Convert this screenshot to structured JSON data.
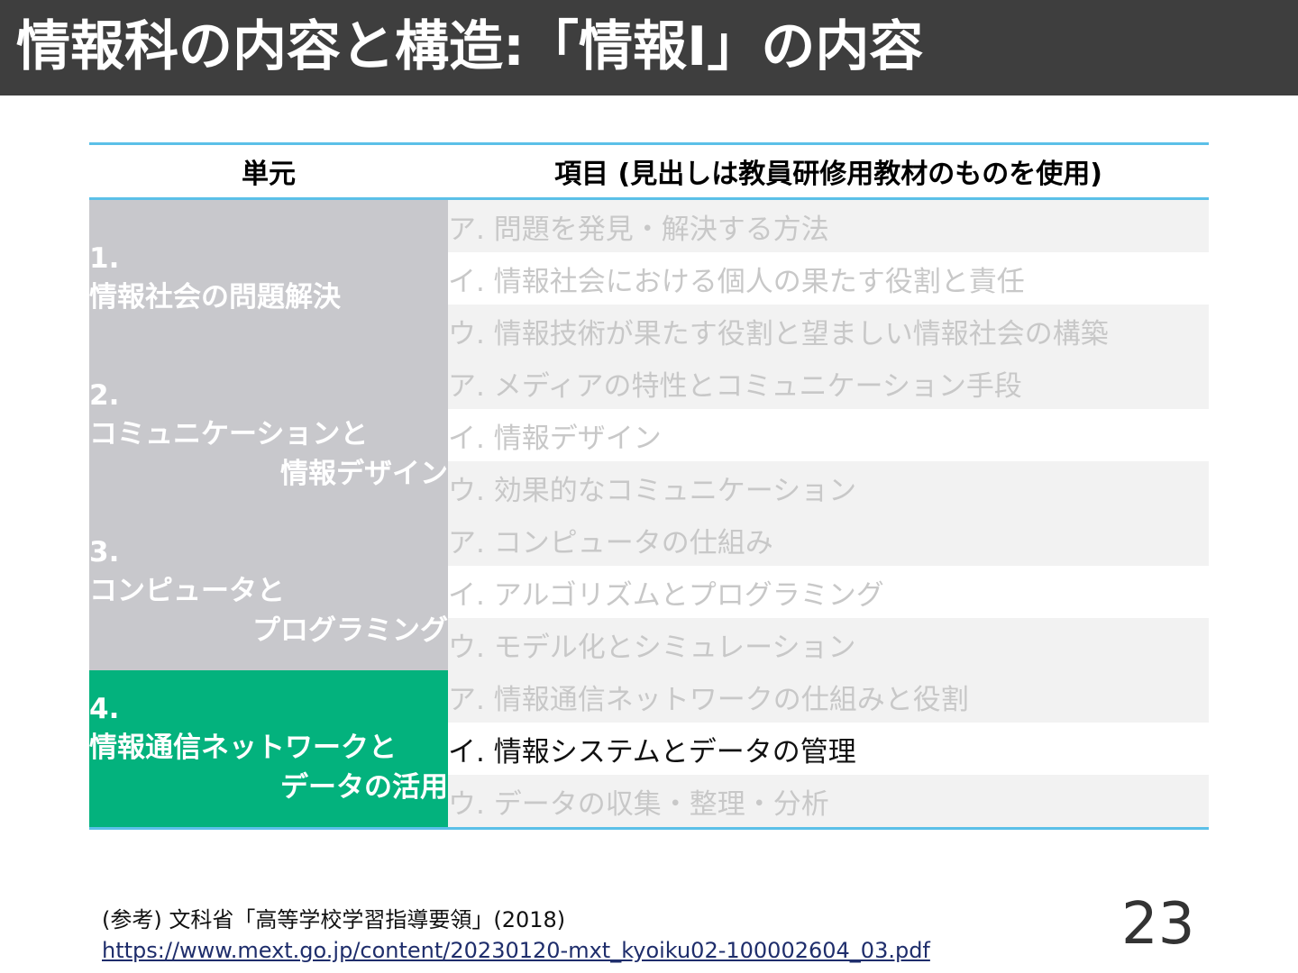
{
  "title": "情報科の内容と構造:「情報I」の内容",
  "table": {
    "headers": [
      "単元",
      "項目 (見出しは教員研修用教材のものを使用)"
    ],
    "units": [
      {
        "number": "1.",
        "line1": "情報社会の問題解決",
        "line2": "",
        "color": "#c8c8cc"
      },
      {
        "number": "2.",
        "line1": "コミュニケーションと",
        "line2": "情報デザイン",
        "color": "#c8c8cc"
      },
      {
        "number": "3.",
        "line1": "コンピュータと",
        "line2": "プログラミング",
        "color": "#c8c8cc"
      },
      {
        "number": "4.",
        "line1": "情報通信ネットワークと",
        "line2": "データの活用",
        "color": "#03b27d"
      }
    ],
    "items": [
      "ア. 問題を発見・解決する方法",
      "イ. 情報社会における個人の果たす役割と責任",
      "ウ. 情報技術が果たす役割と望ましい情報社会の構築",
      "ア. メディアの特性とコミュニケーション手段",
      "イ. 情報デザイン",
      "ウ. 効果的なコミュニケーション",
      "ア. コンピュータの仕組み",
      "イ. アルゴリズムとプログラミング",
      "ウ. モデル化とシミュレーション",
      "ア. 情報通信ネットワークの仕組みと役割",
      "イ. 情報システムとデータの管理",
      "ウ. データの収集・整理・分析"
    ],
    "highlighted_item_color": "#111111",
    "dimmed_item_color": "#c8c8c8"
  },
  "reference": {
    "text": "(参考) 文科省「高等学校学習指導要領」(2018)",
    "url": "https://www.mext.go.jp/content/20230120-mxt_kyoiku02-100002604_03.pdf"
  },
  "page_number": "23"
}
